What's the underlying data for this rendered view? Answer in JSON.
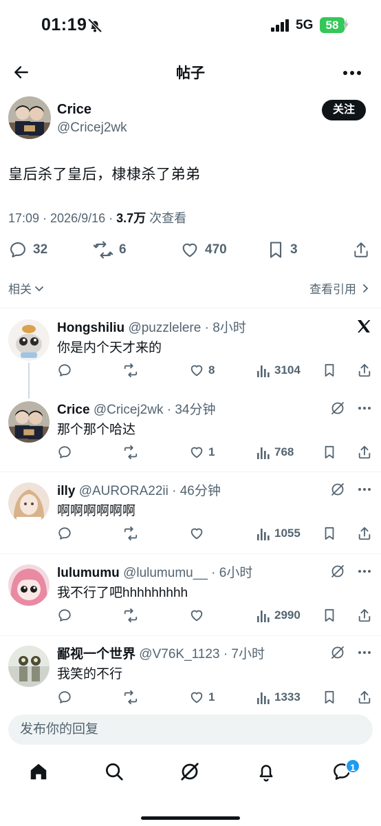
{
  "status_bar": {
    "time": "01:19",
    "network": "5G",
    "battery": "58"
  },
  "header": {
    "title": "帖子"
  },
  "post": {
    "author_name": "Crice",
    "author_handle": "@Cricej2wk",
    "follow_label": "关注",
    "text": "皇后杀了皇后，棣棣杀了弟弟",
    "meta_time": "17:09 · 2026/9/16 · ",
    "meta_views": "3.7万",
    "meta_views_label": " 次查看",
    "stats": {
      "replies": "32",
      "reposts": "6",
      "likes": "470",
      "bookmarks": "3"
    },
    "related_label": "相关",
    "quotes_label": "查看引用"
  },
  "replies": [
    {
      "name": "Hongshiliu",
      "handle": "@puzzlelere",
      "time": "8小时",
      "text": "你是内个天才来的",
      "replies": "",
      "reposts": "",
      "likes": "8",
      "views": "3104"
    },
    {
      "name": "Crice",
      "handle": "@Cricej2wk",
      "time": "34分钟",
      "text": "那个那个哈达",
      "replies": "",
      "reposts": "",
      "likes": "1",
      "views": "768"
    },
    {
      "name": "illy",
      "handle": "@AURORA22ii",
      "time": "46分钟",
      "text": "啊啊啊啊啊啊",
      "replies": "",
      "reposts": "",
      "likes": "",
      "views": "1055"
    },
    {
      "name": "lulumumu",
      "handle": "@lulumumu__",
      "time": "6小时",
      "text": "我不行了吧hhhhhhhhh",
      "replies": "",
      "reposts": "",
      "likes": "",
      "views": "2990"
    },
    {
      "name": "鄙视一个世界",
      "handle": "@V76K_1123",
      "time": "7小时",
      "text": "我笑的不行",
      "replies": "",
      "reposts": "",
      "likes": "1",
      "views": "1333"
    }
  ],
  "compose": {
    "placeholder": "发布你的回复"
  },
  "tabbar": {
    "messages_badge": "1"
  },
  "colors": {
    "text": "#0f1419",
    "secondary": "#536471",
    "accent": "#1d9bf0",
    "battery": "#34c759"
  }
}
